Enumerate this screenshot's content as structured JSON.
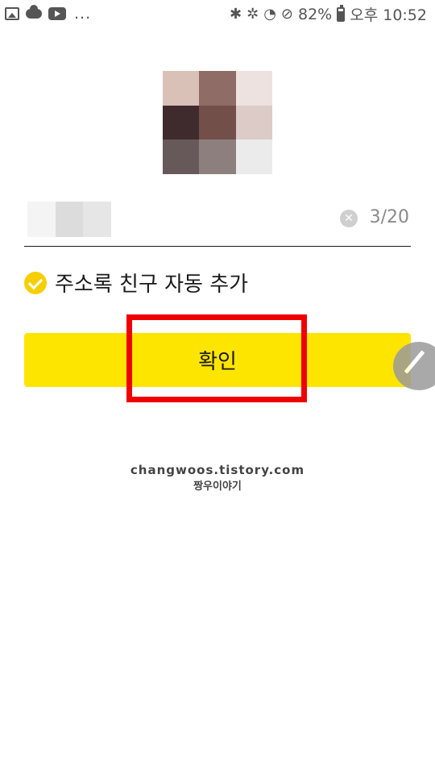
{
  "status_bar": {
    "left_icons": [
      "image-icon",
      "cloud-icon",
      "youtube-icon"
    ],
    "overflow": "...",
    "battery": "82%",
    "time": "오후 10:52",
    "right_icons": [
      "bluetooth-icon",
      "vibrate-icon",
      "wifi-icon",
      "do-not-disturb-icon",
      "battery-icon"
    ]
  },
  "profile": {
    "photo_icon": "blurred-profile-photo",
    "mosaic_colors": [
      "#ffffff",
      "#d9c1b8",
      "#8f6c66",
      "#ede2df",
      "#cfc9c9",
      "#3f2b2d",
      "#724f48",
      "#dccbc6",
      "#ffffff",
      "#f6f3f3",
      "#675959",
      "#8e7f7f",
      "#ebebeb"
    ]
  },
  "name_field": {
    "value": "",
    "char_count": "3/20",
    "clear_icon": "clear-icon"
  },
  "auto_add": {
    "label": "주소록 친구 자동 추가",
    "checked": true
  },
  "confirm": {
    "label": "확인"
  },
  "watermark": {
    "line1": "changwoos.tistory.com",
    "line2": "짱우이야기"
  },
  "colors": {
    "accent_yellow": "#fee500",
    "check_yellow": "#f7cf00",
    "highlight_red": "#ee0000"
  }
}
